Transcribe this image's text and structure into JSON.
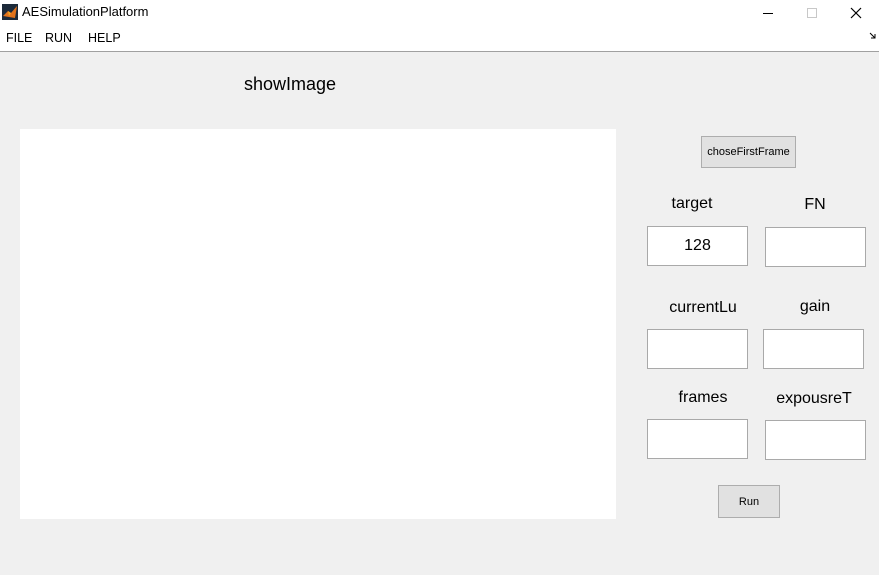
{
  "window": {
    "title": "AESimulationPlatform",
    "controls": {
      "minimize": "minimize-icon",
      "maximize": "maximize-icon",
      "close": "close-icon"
    }
  },
  "menu": {
    "items": [
      "FILE",
      "RUN",
      "HELP"
    ]
  },
  "panel": {
    "image_title": "showImage",
    "choose_button": "choseFirstFrame",
    "run_button": "Run"
  },
  "fields": {
    "target": {
      "label": "target",
      "value": "128"
    },
    "fn": {
      "label": "FN",
      "value": ""
    },
    "currentLu": {
      "label": "currentLu",
      "value": ""
    },
    "gain": {
      "label": "gain",
      "value": ""
    },
    "frames": {
      "label": "frames",
      "value": ""
    },
    "exposureT": {
      "label": "expousreT",
      "value": ""
    }
  },
  "colors": {
    "background": "#f0f0f0",
    "titlebar": "#ffffff",
    "axes": "#ffffff"
  }
}
